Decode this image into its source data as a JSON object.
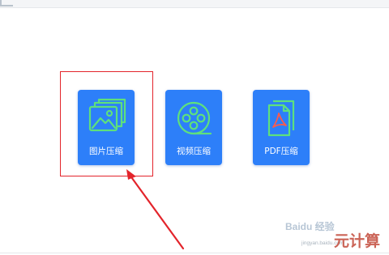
{
  "tools": [
    {
      "label": "图片压缩",
      "icon": "image-compress-icon"
    },
    {
      "label": "视频压缩",
      "icon": "video-reel-icon"
    },
    {
      "label": "PDF压缩",
      "icon": "pdf-document-icon"
    }
  ],
  "watermark": {
    "logo_text": "Baidu 经验",
    "url": "jingyan.baidu.com",
    "site_name": "元计算"
  },
  "colors": {
    "card_background": "#2d7ff9",
    "icon_stroke": "#5ee07d",
    "pdf_symbol": "#ff5a4a",
    "highlight": "#e3242b"
  }
}
